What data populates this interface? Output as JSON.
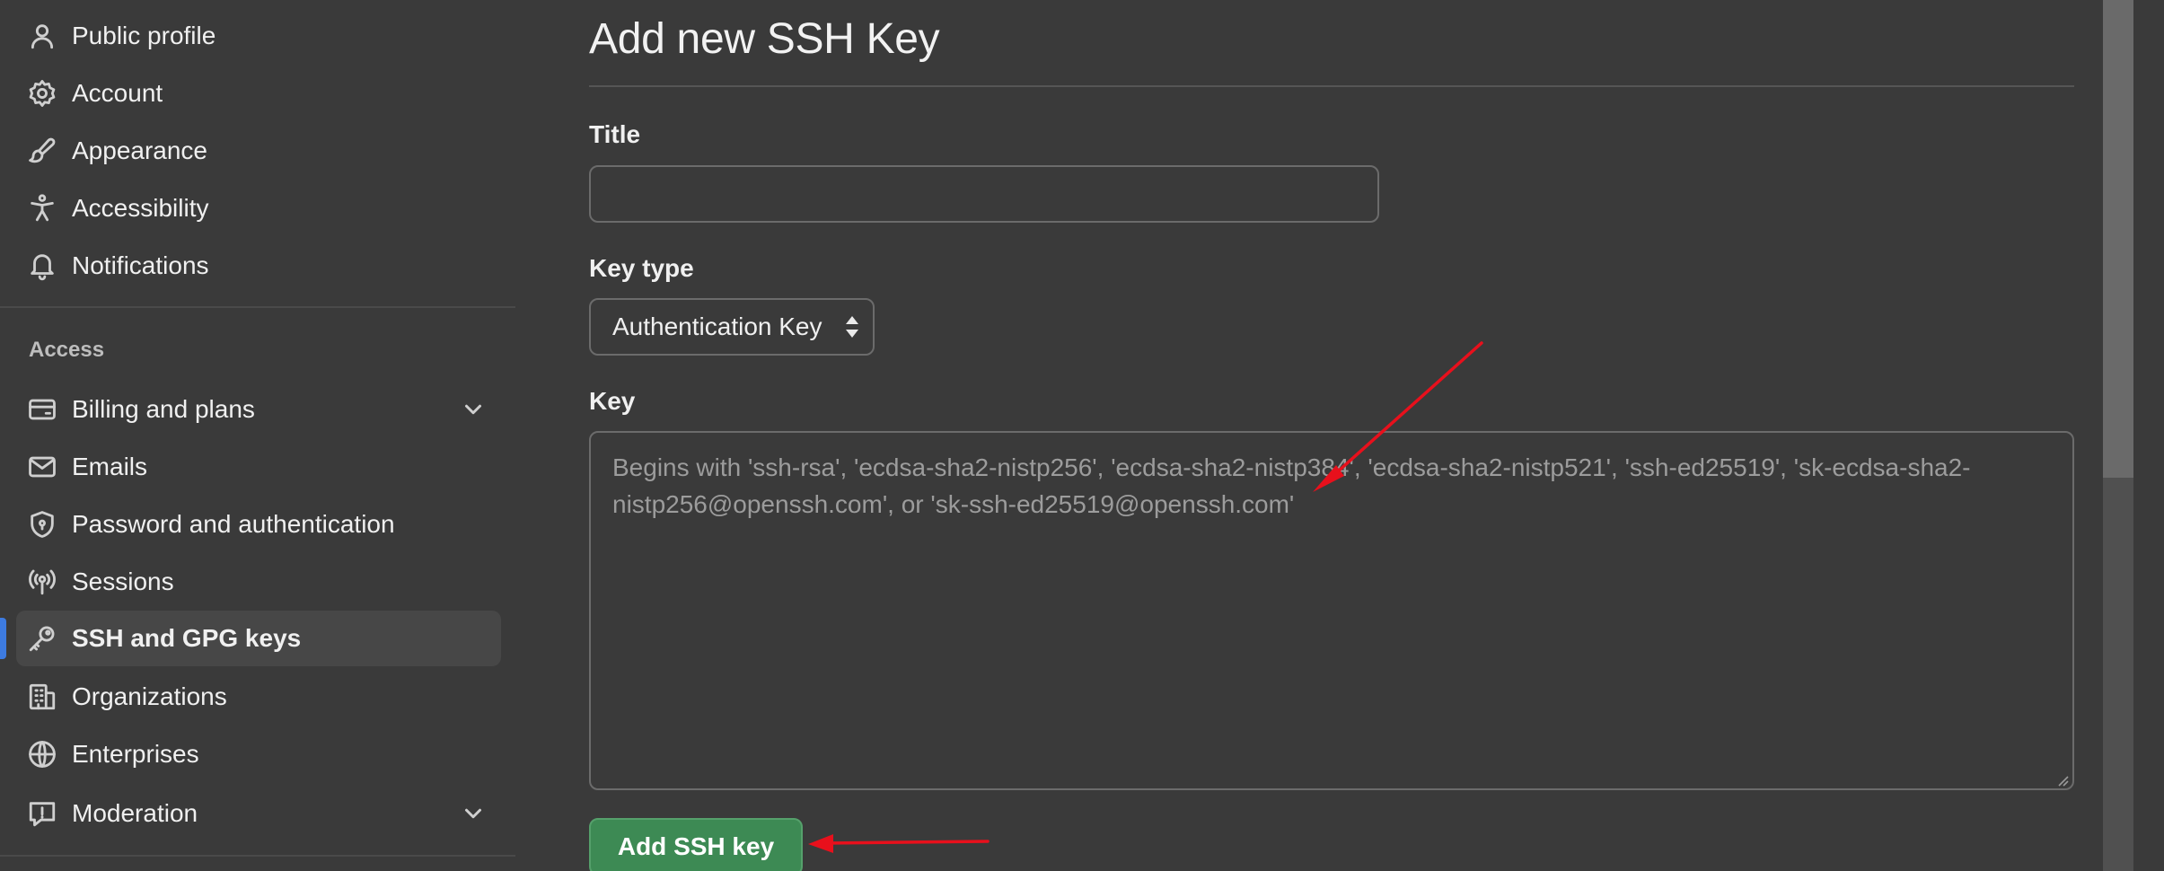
{
  "sidebar": {
    "items_top": [
      {
        "label": "Public profile",
        "icon": "person-icon"
      },
      {
        "label": "Account",
        "icon": "gear-icon"
      },
      {
        "label": "Appearance",
        "icon": "paintbrush-icon"
      },
      {
        "label": "Accessibility",
        "icon": "accessibility-icon"
      },
      {
        "label": "Notifications",
        "icon": "bell-icon"
      }
    ],
    "access_heading": "Access",
    "items_access": [
      {
        "label": "Billing and plans",
        "icon": "credit-card-icon",
        "expandable": true
      },
      {
        "label": "Emails",
        "icon": "mail-icon"
      },
      {
        "label": "Password and authentication",
        "icon": "shield-lock-icon"
      },
      {
        "label": "Sessions",
        "icon": "broadcast-icon"
      },
      {
        "label": "SSH and GPG keys",
        "icon": "key-icon",
        "active": true
      },
      {
        "label": "Organizations",
        "icon": "organization-icon"
      },
      {
        "label": "Enterprises",
        "icon": "globe-icon"
      },
      {
        "label": "Moderation",
        "icon": "report-icon",
        "expandable": true
      }
    ]
  },
  "main": {
    "title": "Add new SSH Key",
    "title_field": {
      "label": "Title",
      "value": ""
    },
    "key_type": {
      "label": "Key type",
      "selected": "Authentication Key"
    },
    "key_field": {
      "label": "Key",
      "placeholder": "Begins with 'ssh-rsa', 'ecdsa-sha2-nistp256', 'ecdsa-sha2-nistp384', 'ecdsa-sha2-nistp521', 'ssh-ed25519', 'sk-ecdsa-sha2-nistp256@openssh.com', or 'sk-ssh-ed25519@openssh.com'"
    },
    "submit_label": "Add SSH key"
  },
  "colors": {
    "background": "#3a3a3a",
    "accent_blue": "#3d7be0",
    "primary_green": "#3d8a54",
    "annotation_red": "#e8101c"
  }
}
